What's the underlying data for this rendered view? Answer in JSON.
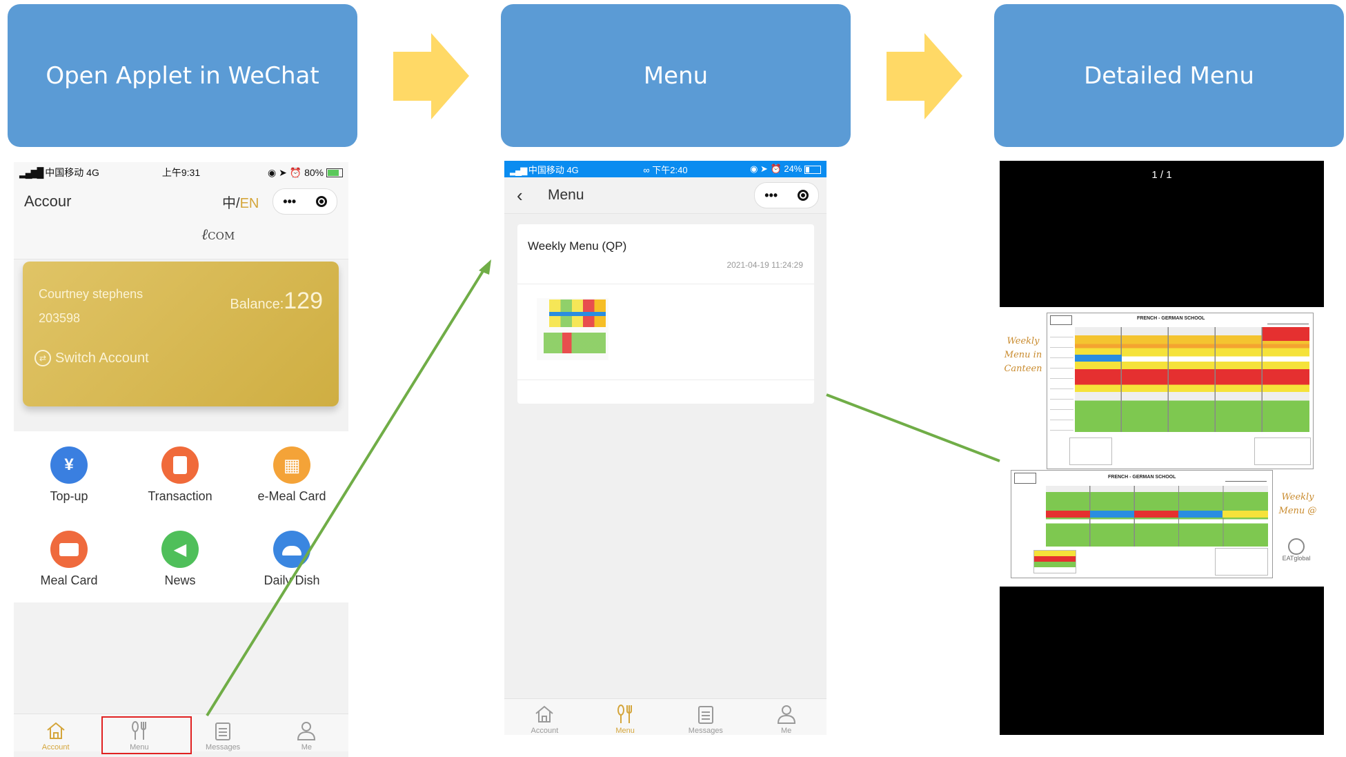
{
  "headers": {
    "step1": "Open Applet in WeChat",
    "step2": "Menu",
    "step3": "Detailed Menu"
  },
  "phone1": {
    "status": {
      "carrier": "中国移动 4G",
      "time": "上午9:31",
      "battery": "80%"
    },
    "nav": {
      "title": "Accour",
      "lang_zh": "中/",
      "lang_en": "EN",
      "capsule_dots": "•••"
    },
    "logo_text": "COM",
    "card": {
      "name": "Courtney stephens",
      "id": "203598",
      "balance_label": "Balance:",
      "balance_value": "129",
      "switch_label": "Switch Account"
    },
    "grid": [
      {
        "label": "Top-up",
        "icon": "yen-shield-icon",
        "color": "#3a7fe0"
      },
      {
        "label": "Transaction",
        "icon": "document-icon",
        "color": "#f06a3a"
      },
      {
        "label": "e-Meal Card",
        "icon": "qr-code-icon",
        "color": "#f4a338"
      },
      {
        "label": "Meal Card",
        "icon": "card-icon",
        "color": "#ef6a3d"
      },
      {
        "label": "News",
        "icon": "speaker-icon",
        "color": "#4fbf5a"
      },
      {
        "label": "Daily Dish",
        "icon": "cloche-icon",
        "color": "#3a86e0"
      }
    ],
    "tabs": [
      "Account",
      "Menu",
      "Messages",
      "Me"
    ]
  },
  "phone2": {
    "status": {
      "carrier": "中国移动 4G",
      "time": "下午2:40",
      "battery": "24%"
    },
    "nav": {
      "title": "Menu",
      "capsule_dots": "•••"
    },
    "item": {
      "title": "Weekly Menu (QP)",
      "timestamp": "2021-04-19 11:24:29"
    },
    "tabs": [
      "Account",
      "Menu",
      "Messages",
      "Me"
    ]
  },
  "phone3": {
    "counter": "1 / 1",
    "menu_top": {
      "school": "FRENCH - GERMAN SCHOOL",
      "note": "Weekly Menu in Canteen"
    },
    "menu_bottom": {
      "school": "FRENCH - GERMAN SCHOOL",
      "note": "Weekly Menu @",
      "brand": "EATglobal"
    }
  },
  "colors": {
    "header_blue": "#5b9bd5",
    "arrow_yellow": "#ffd966",
    "flow_green": "#70ad47",
    "gold_card": "#d8b84e",
    "active_tab": "#d4a53a",
    "status_blue": "#0a8cf0",
    "highlight_red": "#e02020"
  }
}
